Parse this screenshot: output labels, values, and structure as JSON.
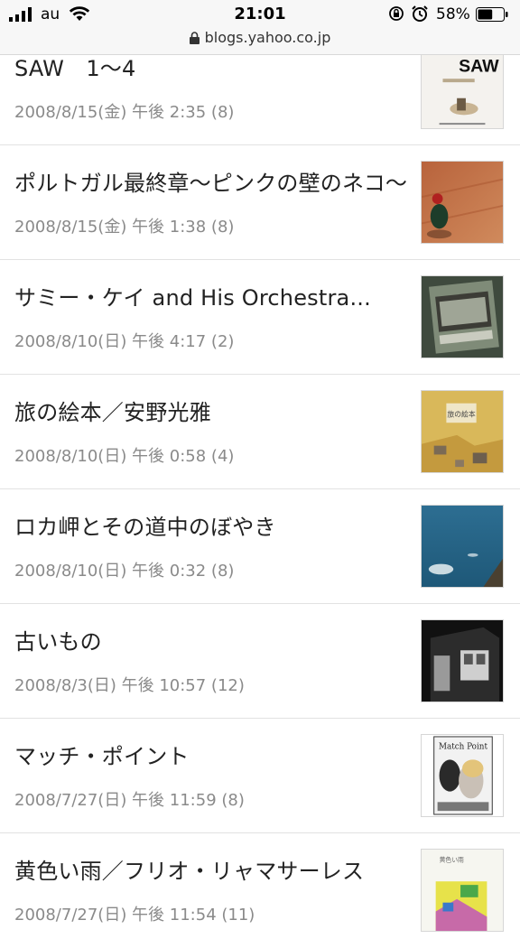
{
  "status_bar": {
    "carrier": "au",
    "time": "21:01",
    "battery": "58%",
    "battery_level": 0.58,
    "url": "blogs.yahoo.co.jp"
  },
  "posts": [
    {
      "title": "SAW　1〜4",
      "meta": "2008/8/15(金) 午後 2:35 (8)",
      "thumb_icon": "saw-poster-thumbnail"
    },
    {
      "title": "ポルトガル最終章〜ピンクの壁のネコ〜",
      "meta": "2008/8/15(金) 午後 1:38 (8)",
      "thumb_icon": "rooster-figurine-thumbnail"
    },
    {
      "title": "サミー・ケイ and His Orchestra...",
      "meta": "2008/8/10(日) 午後 4:17 (2)",
      "thumb_icon": "record-jacket-thumbnail"
    },
    {
      "title": "旅の絵本／安野光雅",
      "meta": "2008/8/10(日) 午後 0:58 (4)",
      "thumb_icon": "picture-book-thumbnail"
    },
    {
      "title": "ロカ岬とその道中のぼやき",
      "meta": "2008/8/10(日) 午後 0:32 (8)",
      "thumb_icon": "ocean-cliff-thumbnail"
    },
    {
      "title": "古いもの",
      "meta": "2008/8/3(日) 午後 10:57 (12)",
      "thumb_icon": "old-building-thumbnail"
    },
    {
      "title": "マッチ・ポイント",
      "meta": "2008/7/27(日) 午後 11:59 (8)",
      "thumb_icon": "match-point-poster-thumbnail"
    },
    {
      "title": "黄色い雨／フリオ・リャマサーレス",
      "meta": "2008/7/27(日) 午後 11:54 (11)",
      "thumb_icon": "book-cover-thumbnail"
    }
  ],
  "thumb_text": {
    "saw": "SAW",
    "book": "旅の絵本",
    "match_point": "Match Point",
    "yellow_rain": "黄色い雨"
  }
}
